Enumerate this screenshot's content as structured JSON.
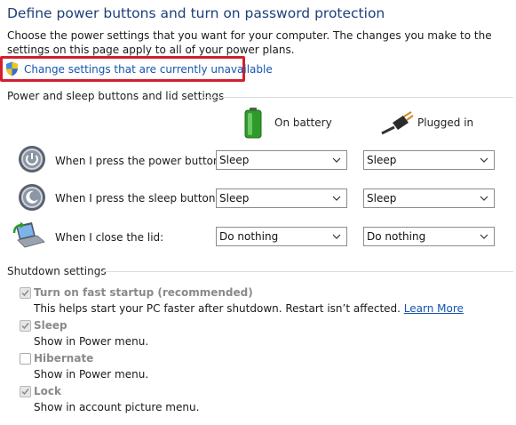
{
  "header": {
    "title": "Define power buttons and turn on password protection",
    "description": "Choose the power settings that you want for your computer. The changes you make to the settings on this page apply to all of your power plans.",
    "change_link": "Change settings that are currently unavailable"
  },
  "power_group": {
    "title": "Power and sleep buttons and lid settings",
    "columns": {
      "battery": "On battery",
      "plugged": "Plugged in"
    },
    "rows": [
      {
        "label": "When I press the power button:",
        "battery": "Sleep",
        "plugged": "Sleep",
        "icon": "power-button-icon"
      },
      {
        "label": "When I press the sleep button:",
        "battery": "Sleep",
        "plugged": "Sleep",
        "icon": "sleep-button-icon"
      },
      {
        "label": "When I close the lid:",
        "battery": "Do nothing",
        "plugged": "Do nothing",
        "icon": "laptop-lid-icon"
      }
    ]
  },
  "shutdown_group": {
    "title": "Shutdown settings",
    "items": [
      {
        "title": "Turn on fast startup (recommended)",
        "desc": "This helps start your PC faster after shutdown. Restart isn’t affected.",
        "link": "Learn More",
        "checked": true
      },
      {
        "title": "Sleep",
        "desc": "Show in Power menu.",
        "checked": true
      },
      {
        "title": "Hibernate",
        "desc": "Show in Power menu.",
        "checked": false
      },
      {
        "title": "Lock",
        "desc": "Show in account picture menu.",
        "checked": true
      }
    ]
  },
  "colors": {
    "title": "#1e3f7a",
    "link": "#1554b0",
    "highlight_box": "#d3202c",
    "disabled_text": "#8a8a8a"
  }
}
